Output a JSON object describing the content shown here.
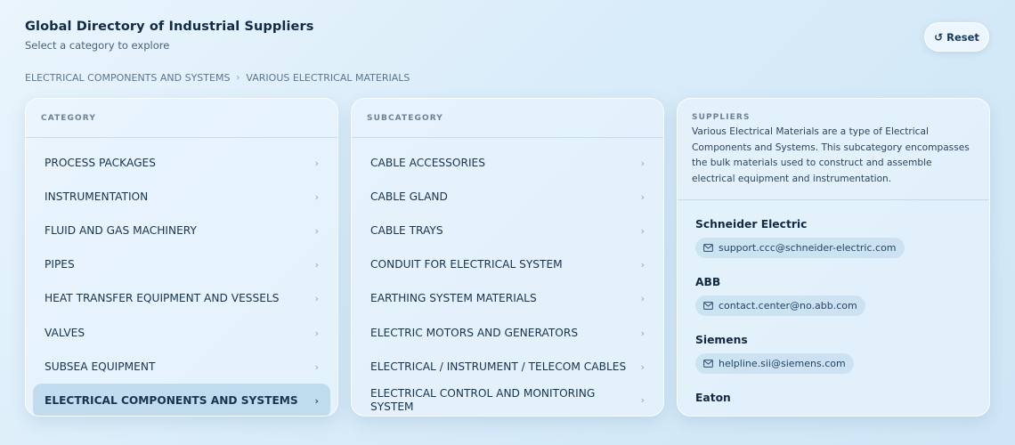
{
  "header": {
    "title": "Global Directory of Industrial Suppliers",
    "subtitle": "Select a category to explore",
    "reset_label": "Reset"
  },
  "breadcrumb": [
    "ELECTRICAL COMPONENTS AND SYSTEMS",
    "VARIOUS ELECTRICAL MATERIALS"
  ],
  "category_panel": {
    "heading": "CATEGORY",
    "items": [
      {
        "label": "PROCESS PACKAGES"
      },
      {
        "label": "INSTRUMENTATION"
      },
      {
        "label": "FLUID AND GAS MACHINERY"
      },
      {
        "label": "PIPES"
      },
      {
        "label": "HEAT TRANSFER EQUIPMENT AND VESSELS"
      },
      {
        "label": "VALVES"
      },
      {
        "label": "SUBSEA EQUIPMENT"
      },
      {
        "label": "ELECTRICAL COMPONENTS AND SYSTEMS"
      }
    ],
    "selected": "ELECTRICAL COMPONENTS AND SYSTEMS"
  },
  "subcategory_panel": {
    "heading": "SUBCATEGORY",
    "items": [
      {
        "label": "CABLE ACCESSORIES"
      },
      {
        "label": "CABLE GLAND"
      },
      {
        "label": "CABLE TRAYS"
      },
      {
        "label": "CONDUIT FOR ELECTRICAL SYSTEM"
      },
      {
        "label": "EARTHING SYSTEM MATERIALS"
      },
      {
        "label": "ELECTRIC MOTORS AND GENERATORS"
      },
      {
        "label": "ELECTRICAL / INSTRUMENT / TELECOM CABLES"
      },
      {
        "label": "ELECTRICAL CONTROL AND MONITORING SYSTEM"
      }
    ]
  },
  "suppliers_panel": {
    "heading": "SUPPLIERS",
    "description": "Various Electrical Materials are a type of Electrical Components and Systems. This subcategory encompasses the bulk materials used to construct and assemble electrical equipment and instrumentation.",
    "suppliers": [
      {
        "name": "Schneider Electric",
        "email": "support.ccc@schneider-electric.com"
      },
      {
        "name": "ABB",
        "email": "contact.center@no.abb.com"
      },
      {
        "name": "Siemens",
        "email": "helpline.sii@siemens.com"
      },
      {
        "name": "Eaton"
      }
    ]
  },
  "icons": {
    "reset": "refresh-icon",
    "chevron": "chevron-right-icon",
    "mail": "mail-icon"
  }
}
